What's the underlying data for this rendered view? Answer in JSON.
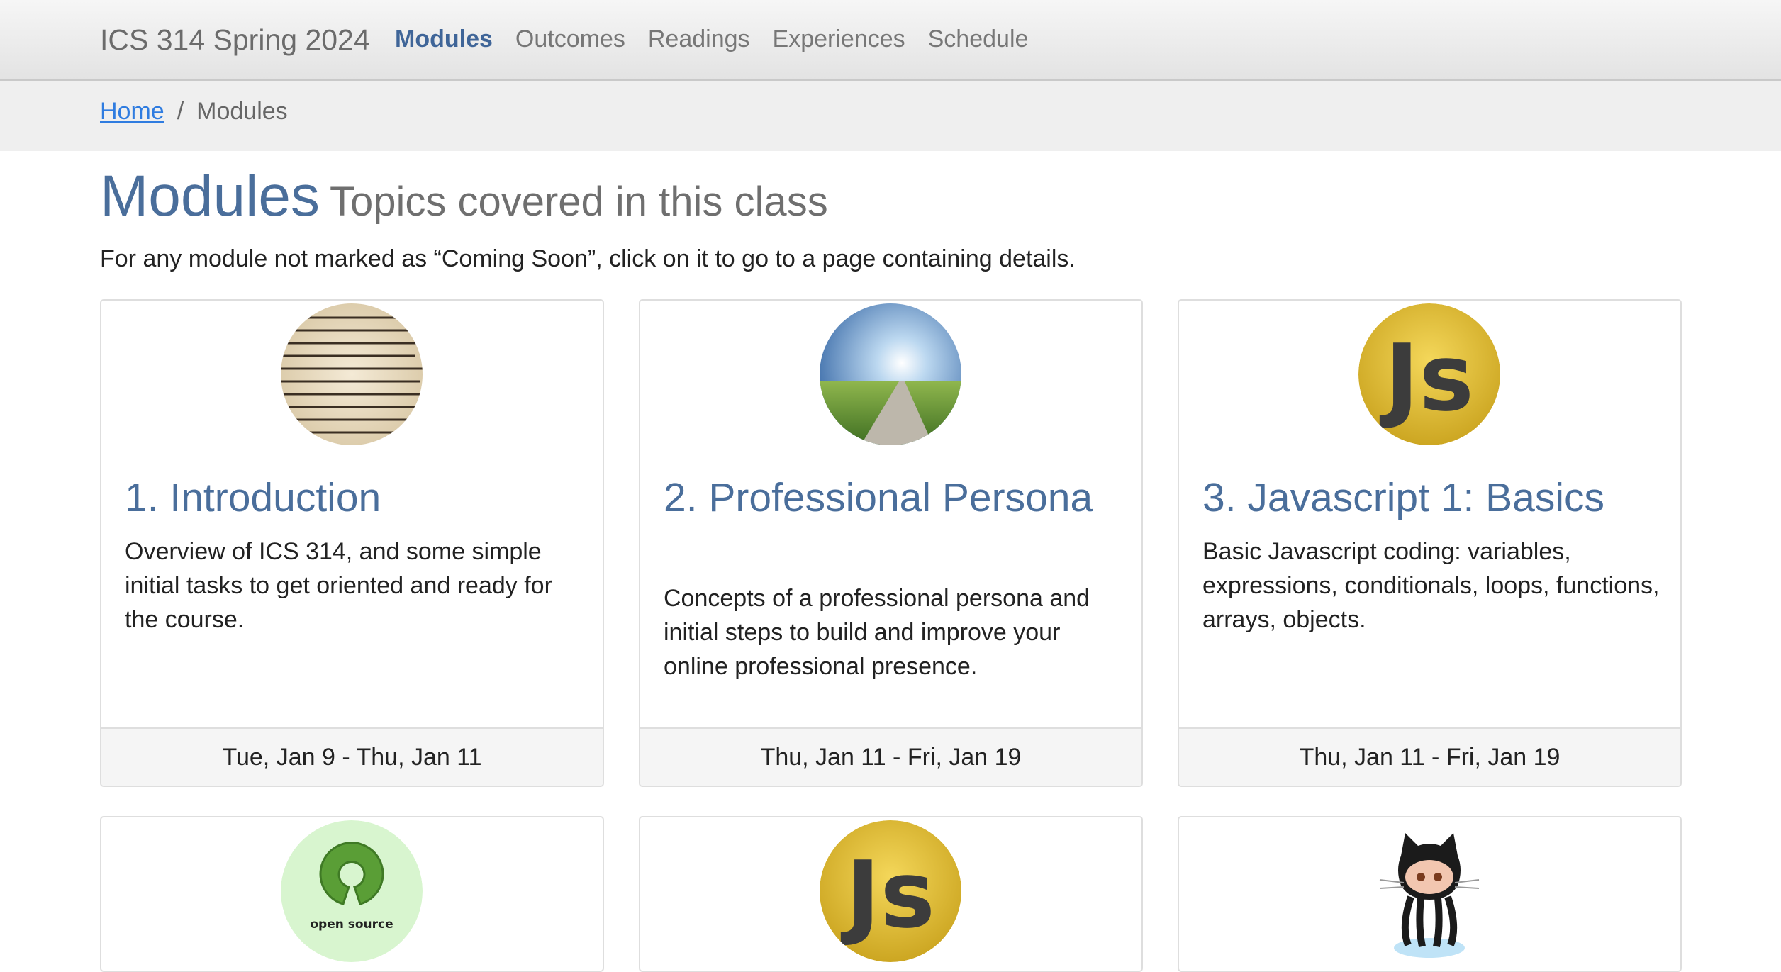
{
  "navbar": {
    "brand": "ICS 314 Spring 2024",
    "items": [
      "Modules",
      "Outcomes",
      "Readings",
      "Experiences",
      "Schedule"
    ]
  },
  "breadcrumb": {
    "home": "Home",
    "separator": "/",
    "current": "Modules"
  },
  "header": {
    "title": "Modules",
    "subtitle": "Topics covered in this class",
    "lead": "For any module not marked as “Coming Soon”, click on it to go to a page containing details."
  },
  "modules": [
    {
      "title": "1. Introduction",
      "desc": "Overview of ICS 314, and some simple initial tasks to get oriented and ready for the course.",
      "dates": "Tue, Jan 9 - Thu, Jan 11",
      "image_icon": "dictionary-introduction-icon"
    },
    {
      "title": "2. Professional Persona",
      "desc": "Concepts of a professional persona and initial steps to build and improve your online professional presence.",
      "dates": "Thu, Jan 11 - Fri, Jan 19",
      "image_icon": "road-horizon-icon"
    },
    {
      "title": "3. Javascript 1: Basics",
      "desc": "Basic Javascript coding: variables, expressions, conditionals, loops, functions, arrays, objects.",
      "dates": "Thu, Jan 11 - Fri, Jan 19",
      "image_icon": "js-logo-icon"
    },
    {
      "image_icon": "open-source-icon",
      "logo_text": "open source"
    },
    {
      "image_icon": "js-logo-icon",
      "logo_text": "Js"
    },
    {
      "image_icon": "github-octocat-icon"
    }
  ],
  "js_logo_text": "Js",
  "colors": {
    "accent": "#4a6e9b",
    "link": "#2f7ce0"
  }
}
